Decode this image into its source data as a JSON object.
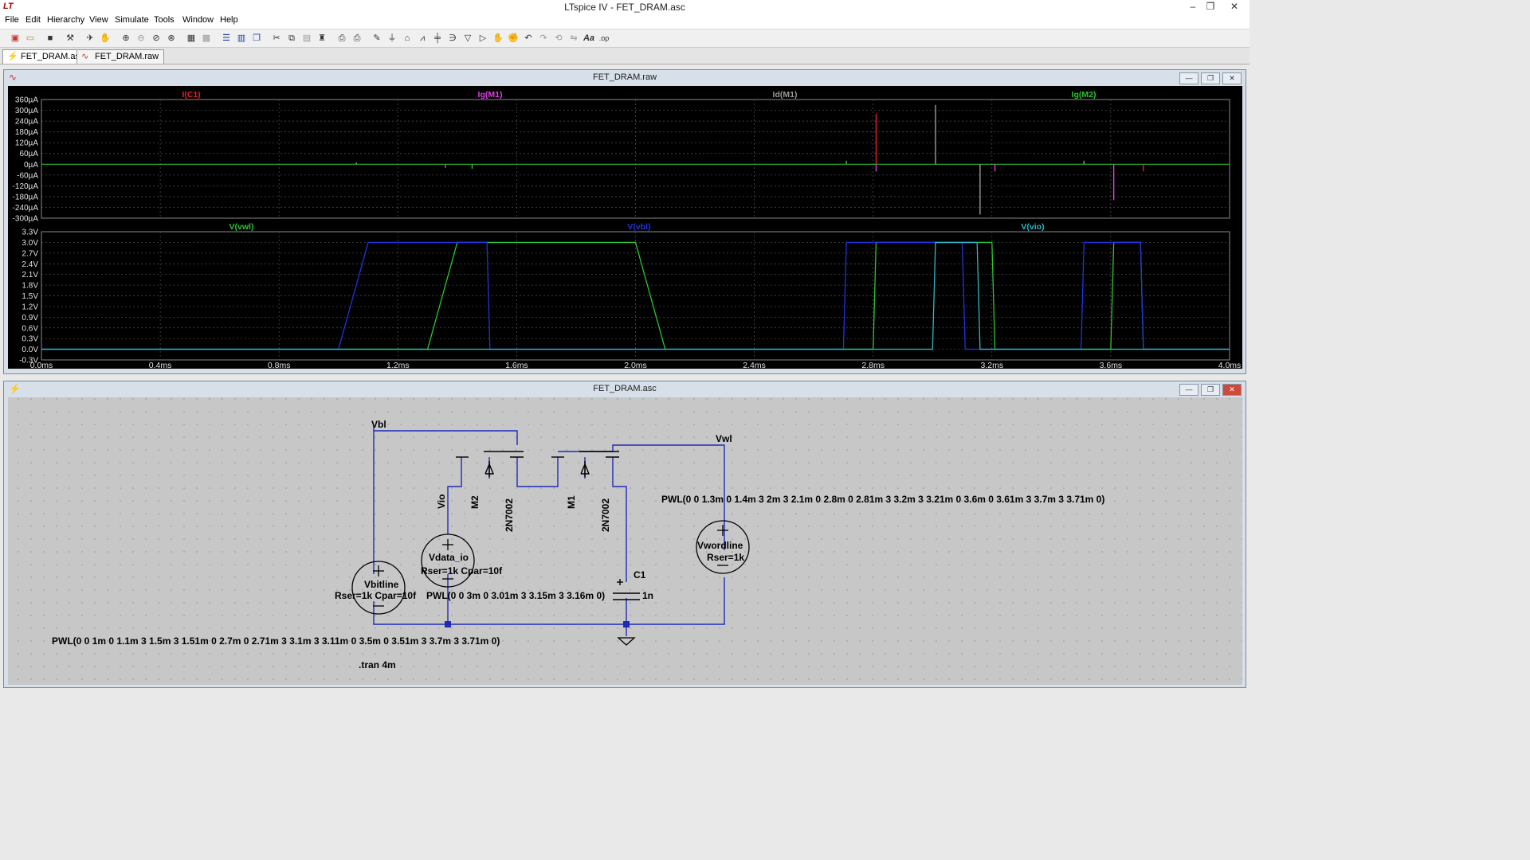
{
  "app": {
    "logo": "LT",
    "title": "LTspice IV - FET_DRAM.asc",
    "controls": {
      "minimize": "–",
      "restore": "❐",
      "close": "✕"
    }
  },
  "menu": [
    "File",
    "Edit",
    "Hierarchy",
    "View",
    "Simulate",
    "Tools",
    "Window",
    "Help"
  ],
  "toolbar_icons": [
    "new-schematic-icon",
    "open-icon",
    "save-icon",
    "control-panel-icon",
    "run-icon",
    "pan-icon",
    "zoom-in-icon",
    "zoom-out-icon",
    "zoom-back-icon",
    "zoom-fit-icon",
    "autorange-icon",
    "grid-icon",
    "tile-horizontal-icon",
    "tile-vertical-icon",
    "cascade-icon",
    "cut-icon",
    "copy-icon",
    "paste-icon",
    "find-icon",
    "print-setup-icon",
    "print-icon",
    "wire-icon",
    "ground-icon",
    "label-icon",
    "resistor-icon",
    "capacitor-icon",
    "inductor-icon",
    "diode-icon",
    "component-icon",
    "move-icon",
    "drag-icon",
    "undo-icon",
    "redo-icon",
    "rotate-icon",
    "mirror-icon",
    "text-icon",
    "spice-directive-icon"
  ],
  "tabs": [
    {
      "label": "FET_DRAM.asc",
      "icon": "schematic-icon"
    },
    {
      "label": "FET_DRAM.raw",
      "icon": "waveform-icon"
    }
  ],
  "plot_window": {
    "title": "FET_DRAM.raw"
  },
  "schematic_window": {
    "title": "FET_DRAM.asc"
  },
  "chart_data": [
    {
      "type": "line",
      "title": "",
      "xlim": [
        0,
        4.0
      ],
      "xunit": "ms",
      "xticks": [
        "0.0ms",
        "0.4ms",
        "0.8ms",
        "1.2ms",
        "1.6ms",
        "2.0ms",
        "2.4ms",
        "2.8ms",
        "3.2ms",
        "3.6ms",
        "4.0ms"
      ],
      "ylim": [
        -300,
        360
      ],
      "yunit": "µA",
      "yticks": [
        "360µA",
        "300µA",
        "240µA",
        "180µA",
        "120µA",
        "60µA",
        "0µA",
        "-60µA",
        "-120µA",
        "-180µA",
        "-240µA",
        "-300µA"
      ],
      "grid": true,
      "series": [
        {
          "name": "I(C1)",
          "color": "#e8202a"
        },
        {
          "name": "Ig(M1)",
          "color": "#e040e0"
        },
        {
          "name": "Id(M1)",
          "color": "#9a9a9a"
        },
        {
          "name": "Ig(M2)",
          "color": "#2ec52e"
        }
      ],
      "spikes": [
        {
          "x": 1.06,
          "y": 10,
          "color": "#9a9a9a"
        },
        {
          "x": 1.36,
          "y": -20,
          "color": "#e040e0"
        },
        {
          "x": 1.45,
          "y": -25,
          "color": "#2ec52e"
        },
        {
          "x": 2.71,
          "y": 20,
          "color": "#2ec52e"
        },
        {
          "x": 2.81,
          "y": 280,
          "color": "#e8202a"
        },
        {
          "x": 2.81,
          "y": -40,
          "color": "#e040e0"
        },
        {
          "x": 3.01,
          "y": 330,
          "color": "#9a9a9a"
        },
        {
          "x": 3.16,
          "y": -280,
          "color": "#9a9a9a"
        },
        {
          "x": 3.21,
          "y": -40,
          "color": "#e040e0"
        },
        {
          "x": 3.51,
          "y": 20,
          "color": "#9a9a9a"
        },
        {
          "x": 3.61,
          "y": -200,
          "color": "#e040e0"
        },
        {
          "x": 3.71,
          "y": -40,
          "color": "#e8202a"
        }
      ]
    },
    {
      "type": "line",
      "title": "",
      "xlim": [
        0,
        4.0
      ],
      "xunit": "ms",
      "ylim": [
        -0.3,
        3.3
      ],
      "yunit": "V",
      "yticks": [
        "3.3V",
        "3.0V",
        "2.7V",
        "2.4V",
        "2.1V",
        "1.8V",
        "1.5V",
        "1.2V",
        "0.9V",
        "0.6V",
        "0.3V",
        "0.0V",
        "-0.3V"
      ],
      "grid": true,
      "series": [
        {
          "name": "V(vwl)",
          "color": "#2ec52e",
          "x": [
            0,
            1.3,
            1.4,
            2.0,
            2.1,
            2.8,
            2.81,
            3.2,
            3.21,
            3.6,
            3.61,
            3.7,
            3.71,
            4.0
          ],
          "y": [
            0,
            0,
            3,
            3,
            0,
            0,
            3,
            3,
            0,
            0,
            3,
            3,
            0,
            0
          ]
        },
        {
          "name": "V(vbl)",
          "color": "#2233dd",
          "x": [
            0,
            1.0,
            1.1,
            1.5,
            1.51,
            2.7,
            2.71,
            3.1,
            3.11,
            3.5,
            3.51,
            3.7,
            3.71,
            4.0
          ],
          "y": [
            0,
            0,
            3,
            3,
            0,
            0,
            3,
            3,
            0,
            0,
            3,
            3,
            0,
            0
          ]
        },
        {
          "name": "V(vio)",
          "color": "#2fb7c0",
          "x": [
            0,
            3.0,
            3.01,
            3.15,
            3.16,
            4.0
          ],
          "y": [
            0,
            0,
            3,
            3,
            0,
            0
          ]
        }
      ]
    }
  ],
  "schematic": {
    "net_labels": {
      "vbl": "Vbl",
      "vwl": "Vwl",
      "vio": "Vio"
    },
    "m2": {
      "name": "M2",
      "model": "2N7002"
    },
    "m1": {
      "name": "M1",
      "model": "2N7002"
    },
    "vdata": {
      "name": "Vdata_io",
      "params": "Rser=1k Cpar=10f",
      "pwl": "PWL(0 0 3m 0 3.01m 3 3.15m 3 3.16m 0)"
    },
    "vbitline": {
      "name": "Vbitline",
      "params": "Rser=1k Cpar=10f",
      "pwl": "PWL(0 0 1m 0 1.1m 3 1.5m 3 1.51m 0 2.7m 0 2.71m 3 3.1m 3 3.11m 0 3.5m 0 3.51m 3 3.7m 3 3.71m 0)"
    },
    "vwordline": {
      "name": "Vwordline",
      "params": "Rser=1k",
      "pwl": "PWL(0 0 1.3m 0 1.4m 3 2m 3 2.1m 0 2.8m 0 2.81m 3 3.2m 3 3.21m 0 3.6m 0 3.61m 3 3.7m 3 3.71m 0)"
    },
    "c1": {
      "name": "C1",
      "value": "1n"
    },
    "directive": ".tran 4m"
  }
}
